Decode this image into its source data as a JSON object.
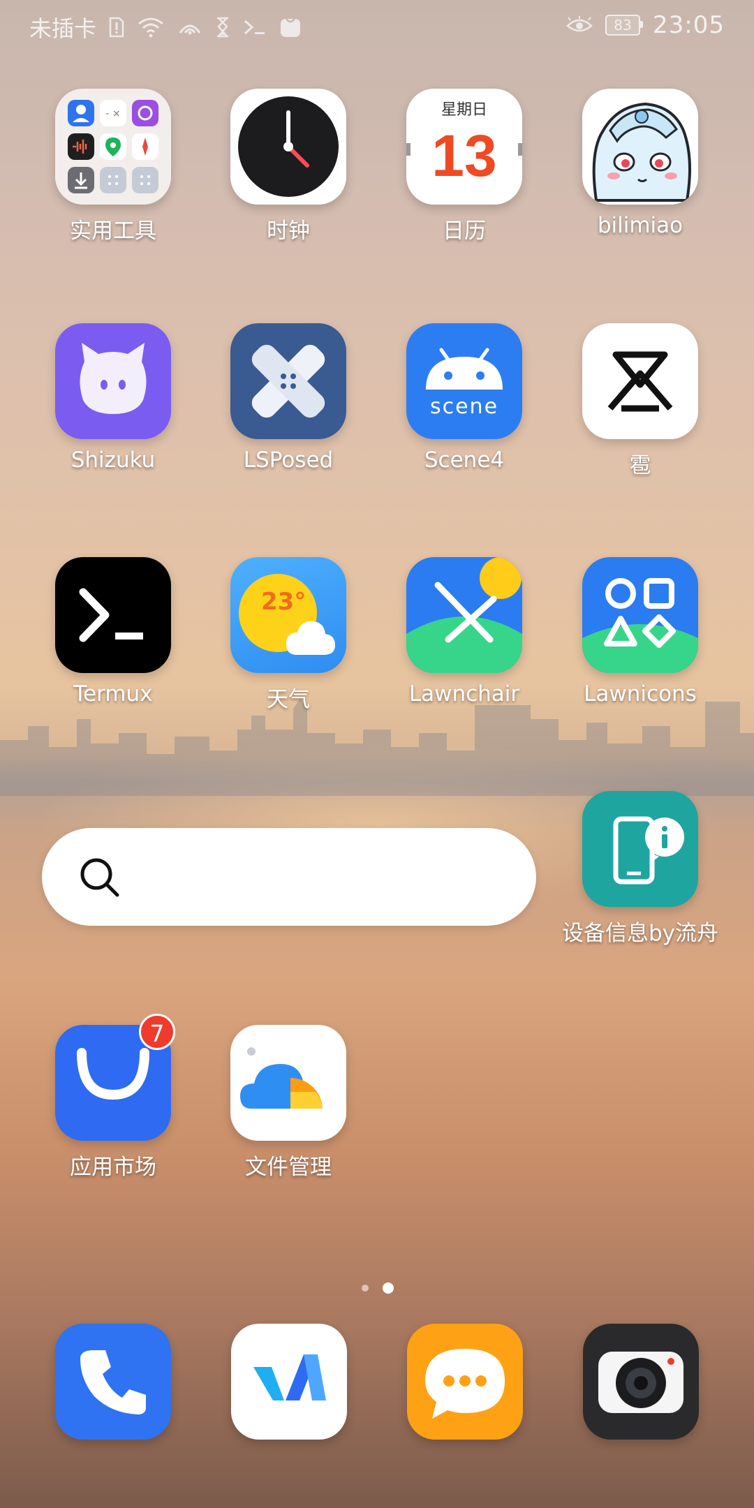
{
  "status_bar": {
    "carrier": "未插卡",
    "battery": "83",
    "time": "23:05",
    "icons_left": [
      "sim-warning-icon",
      "wifi-icon",
      "hotspot-icon",
      "hourglass-icon",
      "terminal-icon",
      "notification-app-icon"
    ],
    "icons_right": [
      "eye-comfort-icon",
      "battery-icon"
    ]
  },
  "home": {
    "row1": [
      {
        "label": "实用工具",
        "icon": "folder-icon"
      },
      {
        "label": "时钟",
        "icon": "clock-icon"
      },
      {
        "label": "日历",
        "icon": "calendar-icon",
        "weekday": "星期日",
        "day": "13"
      },
      {
        "label": "bilimiao",
        "icon": "bilimiao-icon"
      }
    ],
    "row2": [
      {
        "label": "Shizuku",
        "icon": "shizuku-icon"
      },
      {
        "label": "LSPosed",
        "icon": "lsposed-icon"
      },
      {
        "label": "Scene4",
        "icon": "scene-icon",
        "text": "scene"
      },
      {
        "label": "雹",
        "icon": "hail-icon"
      }
    ],
    "row3": [
      {
        "label": "Termux",
        "icon": "termux-icon"
      },
      {
        "label": "天气",
        "icon": "weather-icon",
        "temp": "23°"
      },
      {
        "label": "Lawnchair",
        "icon": "lawnchair-icon"
      },
      {
        "label": "Lawnicons",
        "icon": "lawnicons-icon"
      }
    ],
    "device_info": {
      "label": "设备信息by流舟",
      "icon": "device-info-icon"
    },
    "search": {
      "icon": "search-icon"
    },
    "row5": [
      {
        "label": "应用市场",
        "icon": "app-market-icon",
        "badge": "7"
      },
      {
        "label": "文件管理",
        "icon": "file-manager-icon"
      }
    ]
  },
  "page_indicator": {
    "pages": 2,
    "current": 2
  },
  "dock": [
    {
      "icon": "phone-icon"
    },
    {
      "icon": "browser-icon"
    },
    {
      "icon": "messages-icon"
    },
    {
      "icon": "camera-icon"
    }
  ],
  "colors": {
    "blue": "#2f6bf2",
    "purple": "#7a5ff0",
    "orange": "#ff9c12",
    "teal": "#1fa59f",
    "badge": "#ee3b2d"
  }
}
